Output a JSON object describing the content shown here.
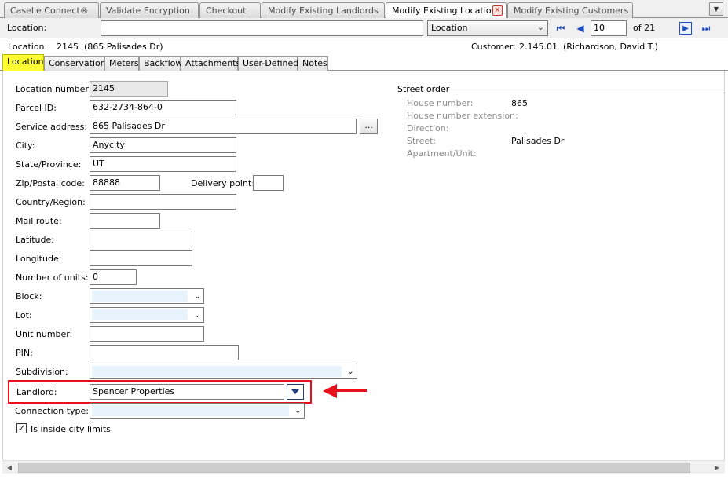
{
  "doc_tabs": [
    {
      "label": "Caselle Connect®"
    },
    {
      "label": "Validate Encryption"
    },
    {
      "label": "Checkout"
    },
    {
      "label": "Modify Existing Landlords"
    },
    {
      "label": "Modify Existing Locations"
    },
    {
      "label": "Modify Existing Customers"
    }
  ],
  "nav": {
    "location_label": "Location:",
    "location_value": "",
    "search_by": "Location",
    "record_number": "10",
    "of_total": "of 21"
  },
  "info": {
    "location_label": "Location:",
    "location_number": "2145",
    "location_address": "(865 Palisades Dr)",
    "customer_label": "Customer:",
    "customer_number": "2.145.01",
    "customer_name": "(Richardson, David T.)"
  },
  "sub_tabs": [
    {
      "label": "Location"
    },
    {
      "label": "Conservation"
    },
    {
      "label": "Meters"
    },
    {
      "label": "Backflow"
    },
    {
      "label": "Attachments"
    },
    {
      "label": "User-Defined"
    },
    {
      "label": "Notes"
    }
  ],
  "form": {
    "location_number": {
      "label": "Location number:",
      "value": "2145"
    },
    "parcel_id": {
      "label": "Parcel ID:",
      "value": "632-2734-864-0"
    },
    "service_address": {
      "label": "Service address:",
      "value": "865 Palisades Dr",
      "button": "..."
    },
    "city": {
      "label": "City:",
      "value": "Anycity"
    },
    "state": {
      "label": "State/Province:",
      "value": "UT"
    },
    "zip": {
      "label": "Zip/Postal code:",
      "value": "88888"
    },
    "delivery_point": {
      "label": "Delivery point:",
      "value": ""
    },
    "country": {
      "label": "Country/Region:",
      "value": ""
    },
    "mail_route": {
      "label": "Mail route:",
      "value": ""
    },
    "latitude": {
      "label": "Latitude:",
      "value": ""
    },
    "longitude": {
      "label": "Longitude:",
      "value": ""
    },
    "number_of_units": {
      "label": "Number of units:",
      "value": "0"
    },
    "block": {
      "label": "Block:",
      "value": ""
    },
    "lot": {
      "label": "Lot:",
      "value": ""
    },
    "unit_number": {
      "label": "Unit number:",
      "value": ""
    },
    "pin": {
      "label": "PIN:",
      "value": ""
    },
    "subdivision": {
      "label": "Subdivision:",
      "value": ""
    },
    "landlord": {
      "label": "Landlord:",
      "value": "Spencer Properties"
    },
    "connection_type": {
      "label": "Connection type:",
      "value": ""
    },
    "inside_city_limits": {
      "label": "Is inside city limits",
      "checked": true
    }
  },
  "street_order": {
    "title": "Street order",
    "house_number": {
      "label": "House number:",
      "value": "865"
    },
    "house_number_extension": {
      "label": "House number extension:",
      "value": ""
    },
    "direction": {
      "label": "Direction:",
      "value": ""
    },
    "street": {
      "label": "Street:",
      "value": "Palisades Dr"
    },
    "apartment_unit": {
      "label": "Apartment/Unit:",
      "value": ""
    }
  },
  "colors": {
    "active_subtab": "#ffff33",
    "annotation_red": "#e8101a",
    "nav_blue": "#1e4fc2"
  }
}
